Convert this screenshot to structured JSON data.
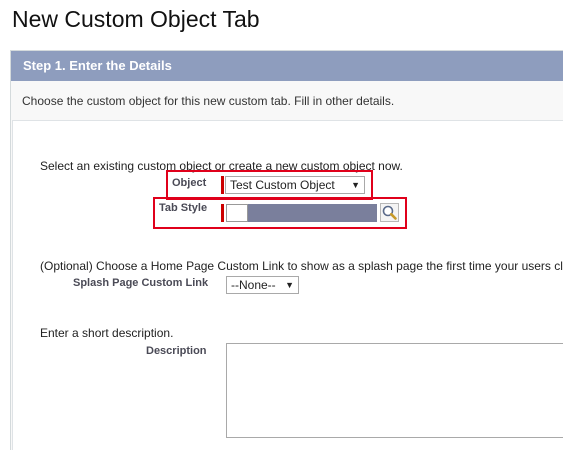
{
  "page": {
    "title": "New Custom Object Tab"
  },
  "step": {
    "header": "Step 1. Enter the Details",
    "intro": "Choose the custom object for this new custom tab. Fill in other details."
  },
  "form": {
    "object_prompt": "Select an existing custom object or create a new custom object now.",
    "object_label": "Object",
    "object_value": "Test Custom Object",
    "tab_style_label": "Tab Style",
    "tab_style_color": "#7a7f9c",
    "splash_prompt": "(Optional) Choose a Home Page Custom Link to show as a splash page the first time your users cl",
    "splash_label": "Splash Page Custom Link",
    "splash_value": "--None--",
    "description_prompt": "Enter a short description.",
    "description_label": "Description",
    "description_value": ""
  },
  "icons": {
    "dropdown": "caret-down",
    "lookup": "magnifier-lookup-icon"
  },
  "colors": {
    "header_bg": "#8e9dbe",
    "highlight": "#e0001b",
    "required": "#c00000"
  }
}
